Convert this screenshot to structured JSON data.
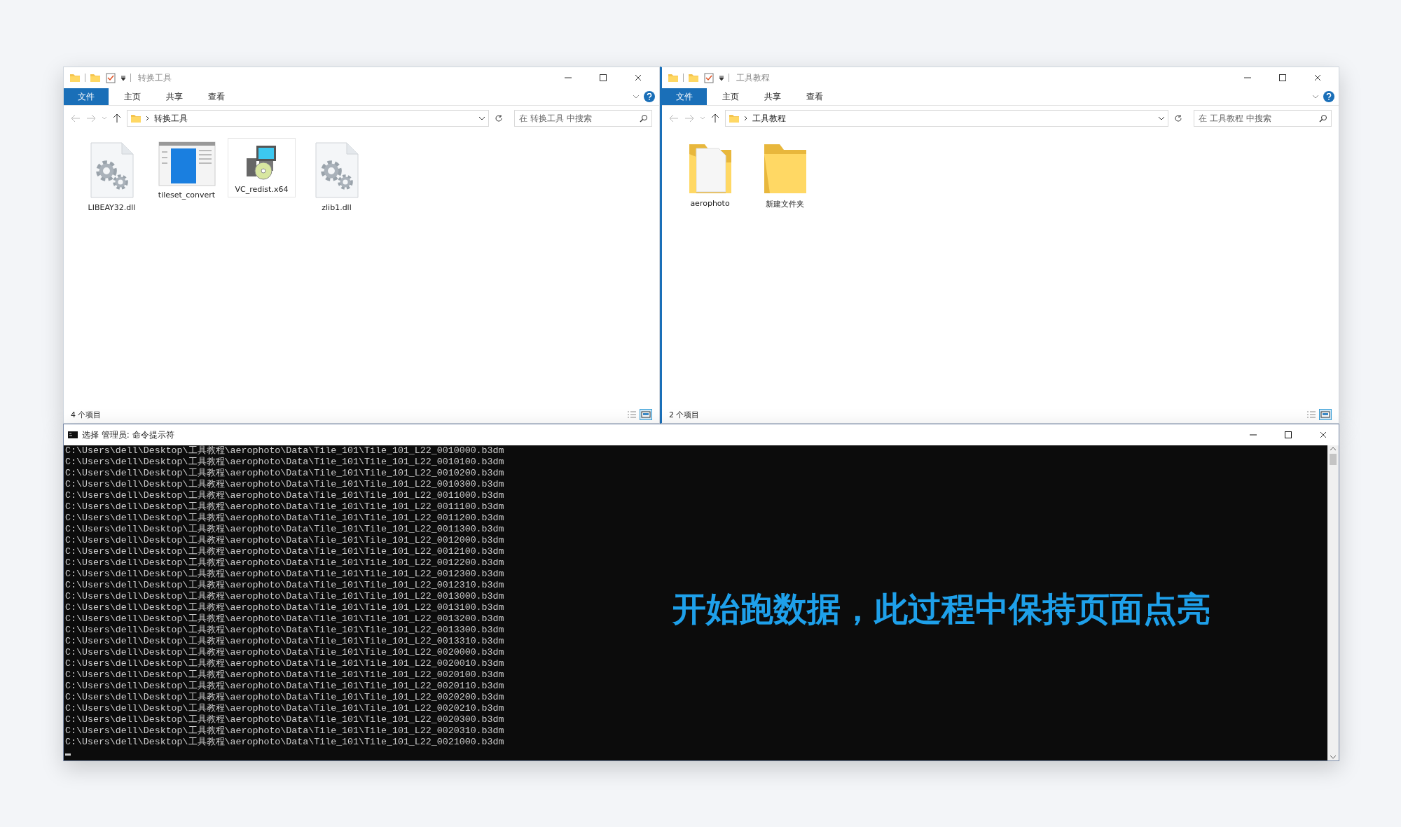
{
  "explorers": [
    {
      "title": "转换工具",
      "tabs": [
        {
          "label": "文件",
          "selected": true
        },
        {
          "label": "主页",
          "selected": false
        },
        {
          "label": "共享",
          "selected": false
        },
        {
          "label": "查看",
          "selected": false
        }
      ],
      "path": "转换工具",
      "search": {
        "placeholder": "在 转换工具 中搜索"
      },
      "items": [
        {
          "name": "LIBEAY32.dll",
          "kind": "dll"
        },
        {
          "name": "tileset_convert",
          "kind": "app"
        },
        {
          "name": "VC_redist.x64",
          "kind": "installer"
        },
        {
          "name": "zlib1.dll",
          "kind": "dll"
        }
      ],
      "status": "4 个项目",
      "views": [
        {
          "kind": "details",
          "selected": false
        },
        {
          "kind": "large-icons",
          "selected": true
        }
      ]
    },
    {
      "title": "工具教程",
      "tabs": [
        {
          "label": "文件",
          "selected": true
        },
        {
          "label": "主页",
          "selected": false
        },
        {
          "label": "共享",
          "selected": false
        },
        {
          "label": "查看",
          "selected": false
        }
      ],
      "path": "工具教程",
      "search": {
        "placeholder": "在 工具教程 中搜索"
      },
      "items": [
        {
          "name": "aerophoto",
          "kind": "folder-with-file"
        },
        {
          "name": "新建文件夹",
          "kind": "folder"
        }
      ],
      "status": "2 个项目",
      "views": [
        {
          "kind": "details",
          "selected": false
        },
        {
          "kind": "large-icons",
          "selected": true
        }
      ]
    }
  ],
  "console": {
    "title": "选择 管理员: 命令提示符",
    "lines": [
      "C:\\Users\\dell\\Desktop\\工具教程\\aerophoto\\Data\\Tile_101\\Tile_101_L22_0010000.b3dm",
      "C:\\Users\\dell\\Desktop\\工具教程\\aerophoto\\Data\\Tile_101\\Tile_101_L22_0010100.b3dm",
      "C:\\Users\\dell\\Desktop\\工具教程\\aerophoto\\Data\\Tile_101\\Tile_101_L22_0010200.b3dm",
      "C:\\Users\\dell\\Desktop\\工具教程\\aerophoto\\Data\\Tile_101\\Tile_101_L22_0010300.b3dm",
      "C:\\Users\\dell\\Desktop\\工具教程\\aerophoto\\Data\\Tile_101\\Tile_101_L22_0011000.b3dm",
      "C:\\Users\\dell\\Desktop\\工具教程\\aerophoto\\Data\\Tile_101\\Tile_101_L22_0011100.b3dm",
      "C:\\Users\\dell\\Desktop\\工具教程\\aerophoto\\Data\\Tile_101\\Tile_101_L22_0011200.b3dm",
      "C:\\Users\\dell\\Desktop\\工具教程\\aerophoto\\Data\\Tile_101\\Tile_101_L22_0011300.b3dm",
      "C:\\Users\\dell\\Desktop\\工具教程\\aerophoto\\Data\\Tile_101\\Tile_101_L22_0012000.b3dm",
      "C:\\Users\\dell\\Desktop\\工具教程\\aerophoto\\Data\\Tile_101\\Tile_101_L22_0012100.b3dm",
      "C:\\Users\\dell\\Desktop\\工具教程\\aerophoto\\Data\\Tile_101\\Tile_101_L22_0012200.b3dm",
      "C:\\Users\\dell\\Desktop\\工具教程\\aerophoto\\Data\\Tile_101\\Tile_101_L22_0012300.b3dm",
      "C:\\Users\\dell\\Desktop\\工具教程\\aerophoto\\Data\\Tile_101\\Tile_101_L22_0012310.b3dm",
      "C:\\Users\\dell\\Desktop\\工具教程\\aerophoto\\Data\\Tile_101\\Tile_101_L22_0013000.b3dm",
      "C:\\Users\\dell\\Desktop\\工具教程\\aerophoto\\Data\\Tile_101\\Tile_101_L22_0013100.b3dm",
      "C:\\Users\\dell\\Desktop\\工具教程\\aerophoto\\Data\\Tile_101\\Tile_101_L22_0013200.b3dm",
      "C:\\Users\\dell\\Desktop\\工具教程\\aerophoto\\Data\\Tile_101\\Tile_101_L22_0013300.b3dm",
      "C:\\Users\\dell\\Desktop\\工具教程\\aerophoto\\Data\\Tile_101\\Tile_101_L22_0013310.b3dm",
      "C:\\Users\\dell\\Desktop\\工具教程\\aerophoto\\Data\\Tile_101\\Tile_101_L22_0020000.b3dm",
      "C:\\Users\\dell\\Desktop\\工具教程\\aerophoto\\Data\\Tile_101\\Tile_101_L22_0020010.b3dm",
      "C:\\Users\\dell\\Desktop\\工具教程\\aerophoto\\Data\\Tile_101\\Tile_101_L22_0020100.b3dm",
      "C:\\Users\\dell\\Desktop\\工具教程\\aerophoto\\Data\\Tile_101\\Tile_101_L22_0020110.b3dm",
      "C:\\Users\\dell\\Desktop\\工具教程\\aerophoto\\Data\\Tile_101\\Tile_101_L22_0020200.b3dm",
      "C:\\Users\\dell\\Desktop\\工具教程\\aerophoto\\Data\\Tile_101\\Tile_101_L22_0020210.b3dm",
      "C:\\Users\\dell\\Desktop\\工具教程\\aerophoto\\Data\\Tile_101\\Tile_101_L22_0020300.b3dm",
      "C:\\Users\\dell\\Desktop\\工具教程\\aerophoto\\Data\\Tile_101\\Tile_101_L22_0020310.b3dm",
      "C:\\Users\\dell\\Desktop\\工具教程\\aerophoto\\Data\\Tile_101\\Tile_101_L22_0021000.b3dm"
    ],
    "caption": "开始跑数据，此过程中保持页面点亮"
  }
}
